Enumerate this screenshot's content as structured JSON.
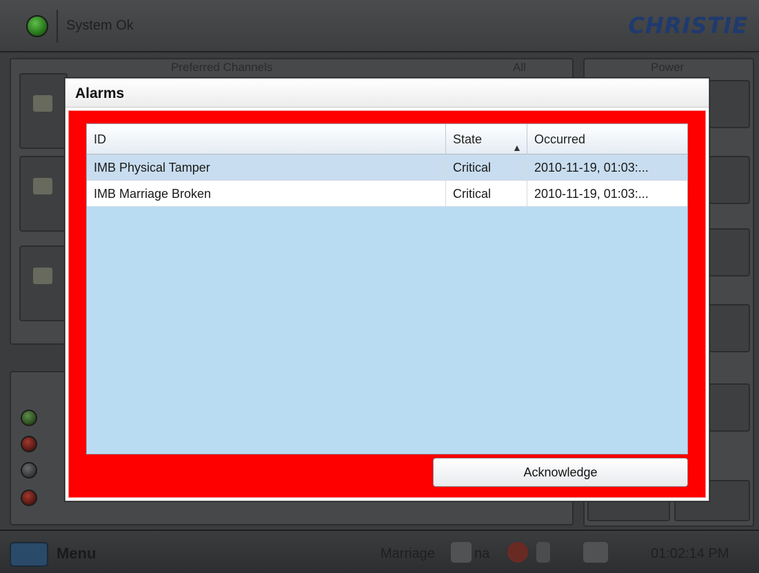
{
  "topbar": {
    "status_text": "System Ok",
    "brand": "CHRISTIE"
  },
  "panels": {
    "preferred_channels_title": "Preferred Channels",
    "all_title": "All",
    "power_title": "Power"
  },
  "dialog": {
    "title": "Alarms",
    "columns": [
      "ID",
      "State",
      "Occurred"
    ],
    "sort_indicator": "▲",
    "rows": [
      {
        "id": "IMB Physical Tamper",
        "state": "Critical",
        "occurred": "2010-11-19, 01:03:..."
      },
      {
        "id": "IMB Marriage Broken",
        "state": "Critical",
        "occurred": "2010-11-19, 01:03:..."
      }
    ],
    "acknowledge_label": "Acknowledge"
  },
  "bottombar": {
    "menu_label": "Menu",
    "marriage_label": "Marriage",
    "na_label": "na",
    "time": "01:02:14 PM"
  },
  "colors": {
    "dialog_body": "#ff0000",
    "table_bg": "#b9dcf3",
    "status_led": "#3fa52a"
  }
}
